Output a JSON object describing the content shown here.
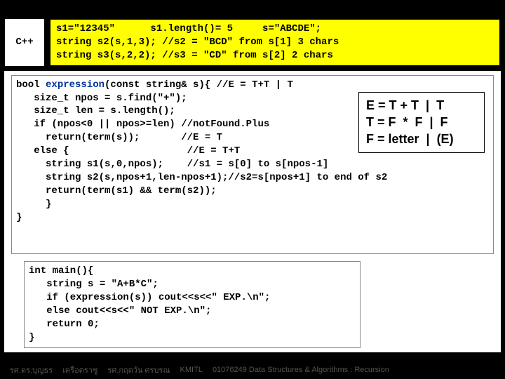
{
  "lang_badge": "C++",
  "yellow_box": "s1=\"12345\"      s1.length()= 5     s=\"ABCDE\";\nstring s2(s,1,3); //s2 = \"BCD\" from s[1] 3 chars\nstring s3(s,2,2); //s3 = \"CD\" from s[2] 2 chars",
  "code_block1_pre": "bool ",
  "code_block1_kw": "expression",
  "code_block1_post": "(const string& s){ //E = T+T | T\n   size_t npos = s.find(\"+\");\n   size_t len = s.length();\n   if (npos<0 || npos>=len) //notFound.Plus\n     return(term(s));       //E = T\n   else {                    //E = T+T\n     string s1(s,0,npos);    //s1 = s[0] to s[npos-1]\n     string s2(s,npos+1,len-npos+1);//s2=s[npos+1] to end of s2\n     return(term(s1) && term(s2));\n     }\n}",
  "grammar_box": "E = T + T  |  T\nT = F  *  F  |  F\nF = letter  |  (E)",
  "code_block2": "int main(){\n   string s = \"A+B*C\";\n   if (expression(s)) cout<<s<<\" EXP.\\n\";\n   else cout<<s<<\" NOT EXP.\\n\";\n   return 0;\n}",
  "footer": {
    "f1": "รศ.ดร.บุญธร",
    "f2": "เครือตราชู",
    "f3": "รศ.กฤตวัน  ศรบรณ",
    "f4": "KMITL",
    "f5": "01076249 Data Structures & Algorithms : Recursion"
  }
}
